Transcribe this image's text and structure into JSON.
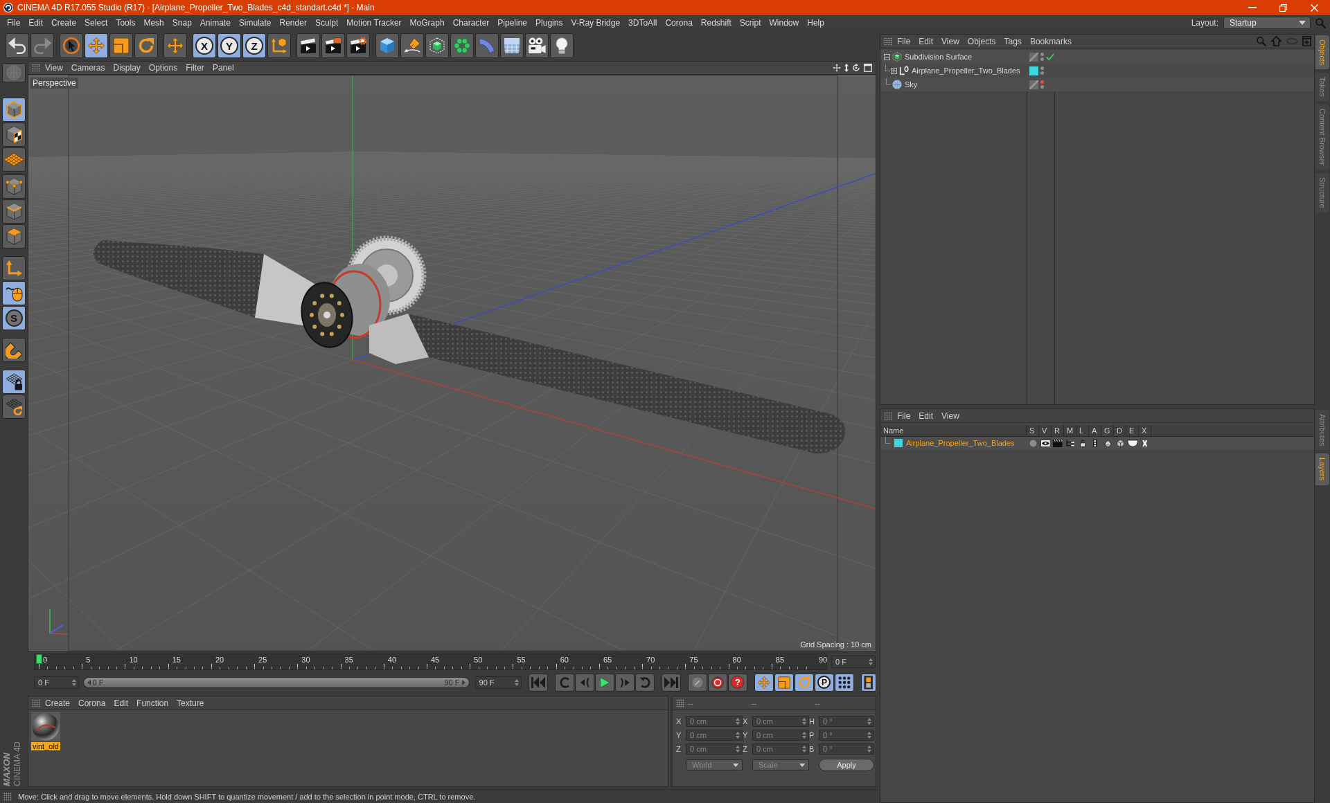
{
  "window": {
    "title": "CINEMA 4D R17.055 Studio (R17) - [Airplane_Propeller_Two_Blades_c4d_standart.c4d *] - Main"
  },
  "menu_bar": [
    "File",
    "Edit",
    "Create",
    "Select",
    "Tools",
    "Mesh",
    "Snap",
    "Animate",
    "Simulate",
    "Render",
    "Sculpt",
    "Motion Tracker",
    "MoGraph",
    "Character",
    "Pipeline",
    "Plugins",
    "V-Ray Bridge",
    "3DToAll",
    "Corona",
    "Redshift",
    "Script",
    "Window",
    "Help"
  ],
  "layout": {
    "label": "Layout:",
    "value": "Startup"
  },
  "toolbar": [
    [
      {
        "kind": "undo",
        "active": false,
        "disabled": false
      },
      {
        "kind": "redo",
        "active": false,
        "disabled": true
      }
    ],
    [
      {
        "kind": "select",
        "active": false
      },
      {
        "kind": "move",
        "active": true
      },
      {
        "kind": "scale",
        "active": false
      },
      {
        "kind": "rotate",
        "active": false
      }
    ],
    [
      {
        "kind": "last",
        "active": false
      }
    ],
    [
      {
        "kind": "axis",
        "label": "X",
        "active": true
      },
      {
        "kind": "axis",
        "label": "Y",
        "active": true
      },
      {
        "kind": "axis",
        "label": "Z",
        "active": true
      },
      {
        "kind": "coords",
        "active": false
      }
    ],
    [
      {
        "kind": "render",
        "active": false
      },
      {
        "kind": "renderpv",
        "active": false
      },
      {
        "kind": "rendersettings",
        "active": false
      }
    ],
    [
      {
        "kind": "cube",
        "active": false
      },
      {
        "kind": "pen",
        "active": false
      },
      {
        "kind": "subdivision",
        "active": false
      },
      {
        "kind": "cloner",
        "active": false
      },
      {
        "kind": "deformer",
        "active": false
      },
      {
        "kind": "floor",
        "active": false
      },
      {
        "kind": "camera",
        "active": false
      },
      {
        "kind": "light",
        "active": false
      }
    ]
  ],
  "left_tools": [
    [
      {
        "kind": "editable",
        "active": false,
        "disabled": true
      }
    ],
    [
      {
        "kind": "model",
        "active": true
      },
      {
        "kind": "texture",
        "active": false
      },
      {
        "kind": "workplane",
        "active": false
      }
    ],
    [
      {
        "kind": "points",
        "active": false
      },
      {
        "kind": "edges",
        "active": false
      },
      {
        "kind": "polygons",
        "active": false
      }
    ],
    [
      {
        "kind": "axismode",
        "active": false
      },
      {
        "kind": "tweak",
        "active": true
      },
      {
        "kind": "solo",
        "label": "S",
        "active": true
      }
    ],
    [
      {
        "kind": "snap",
        "active": false
      }
    ],
    [
      {
        "kind": "lock",
        "active": true
      },
      {
        "kind": "align",
        "active": false
      }
    ]
  ],
  "viewport": {
    "menu": [
      "View",
      "Cameras",
      "Display",
      "Options",
      "Filter",
      "Panel"
    ],
    "camera": "Perspective",
    "grid_spacing": "Grid Spacing : 10 cm"
  },
  "timeline": {
    "ticks": [
      "0",
      "5",
      "10",
      "15",
      "20",
      "25",
      "30",
      "35",
      "40",
      "45",
      "50",
      "55",
      "60",
      "65",
      "70",
      "75",
      "80",
      "85",
      "90"
    ],
    "level": 0,
    "current_frame": "0 F"
  },
  "transport": {
    "start_field": "0 F",
    "range": {
      "start": "0 F",
      "end": "90 F",
      "level": 1
    },
    "end_field": "90 F",
    "playback": [
      [
        {
          "kind": "start"
        }
      ],
      [
        {
          "kind": "prevkey"
        },
        {
          "kind": "prev"
        },
        {
          "kind": "play"
        },
        {
          "kind": "next"
        },
        {
          "kind": "nextkey"
        }
      ],
      [
        {
          "kind": "end"
        }
      ]
    ],
    "record": [
      {
        "kind": "keyrecord"
      },
      {
        "kind": "autokey"
      },
      {
        "kind": "keyselection",
        "label": "?"
      }
    ],
    "key_tools": [
      {
        "kind": "move",
        "active": true
      },
      {
        "kind": "scale",
        "active": true
      },
      {
        "kind": "rotate",
        "active": true
      },
      {
        "kind": "param",
        "label": "P",
        "active": true
      },
      {
        "kind": "points",
        "active": true
      }
    ],
    "timeline_toggle": {
      "active": true
    }
  },
  "materials": {
    "menu": [
      "Create",
      "Corona",
      "Edit",
      "Function",
      "Texture"
    ],
    "items": [
      {
        "name": "vint_old",
        "selected": true
      }
    ]
  },
  "coordinates": {
    "headers": [
      "--",
      "--",
      "--"
    ],
    "rows": [
      {
        "position_axis": "X",
        "position": "0 cm",
        "size_axis": "X",
        "size": "0 cm",
        "rotation_axis": "H",
        "rotation": "0 °"
      },
      {
        "position_axis": "Y",
        "position": "0 cm",
        "size_axis": "Y",
        "size": "0 cm",
        "rotation_axis": "P",
        "rotation": "0 °"
      },
      {
        "position_axis": "Z",
        "position": "0 cm",
        "size_axis": "Z",
        "size": "0 cm",
        "rotation_axis": "B",
        "rotation": "0 °"
      }
    ],
    "mode": "World",
    "size_mode": "Scale",
    "apply": "Apply"
  },
  "status_bar": "Move: Click and drag to move elements. Hold down SHIFT to quantize movement / add to the selection in point mode, CTRL to remove.",
  "logo": {
    "brand": "MAXON",
    "product": "CINEMA 4D"
  },
  "object_manager": {
    "menu": [
      "File",
      "Edit",
      "View",
      "Objects",
      "Tags",
      "Bookmarks"
    ],
    "objects": [
      {
        "name": "Subdivision Surface",
        "kind": "subdivision",
        "expanded": true,
        "enabled": true,
        "editor_hidden": false,
        "children": [
          {
            "name": "Airplane_Propeller_Two_Blades",
            "kind": "null",
            "expanded": false,
            "color": "#40d6de",
            "editor_hidden": false
          }
        ]
      },
      {
        "name": "Sky",
        "kind": "sky",
        "editor_hidden": true
      }
    ]
  },
  "layer_manager": {
    "menu": [
      "File",
      "Edit",
      "View"
    ],
    "columns": [
      "Name",
      "S",
      "V",
      "R",
      "M",
      "L",
      "A",
      "G",
      "D",
      "E",
      "X"
    ],
    "layers": [
      {
        "name": "Airplane_Propeller_Two_Blades",
        "color": "#40d6de",
        "selected": true
      }
    ]
  },
  "side_tabs": {
    "upper": [
      {
        "label": "Objects",
        "selected": true
      },
      {
        "label": "Takes",
        "selected": false
      },
      {
        "label": "Content Browser",
        "selected": false
      },
      {
        "label": "Structure",
        "selected": false
      }
    ],
    "lower": [
      {
        "label": "Attributes",
        "selected": false
      },
      {
        "label": "Layers",
        "selected": true
      }
    ]
  }
}
